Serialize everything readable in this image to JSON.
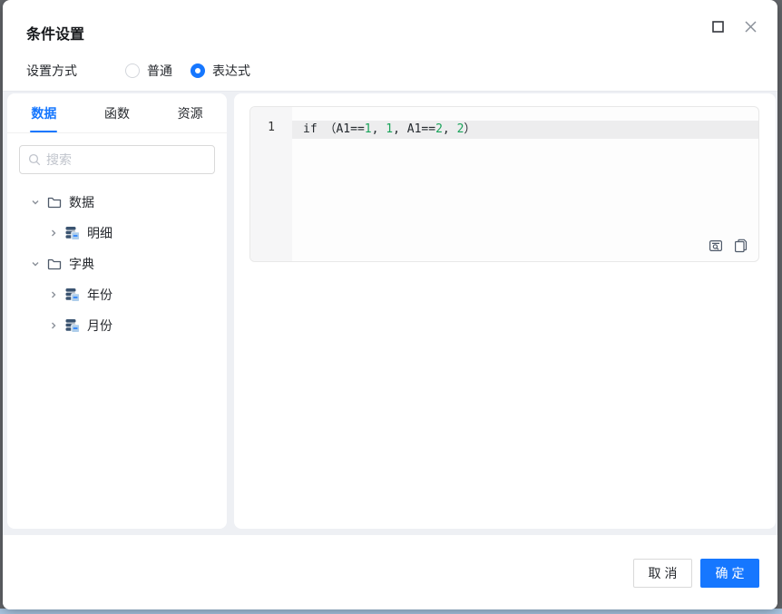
{
  "dialog": {
    "title": "条件设置",
    "mode": {
      "label": "设置方式",
      "options": [
        {
          "label": "普通",
          "selected": false
        },
        {
          "label": "表达式",
          "selected": true
        }
      ]
    }
  },
  "sidebar": {
    "tabs": [
      {
        "label": "数据",
        "active": true
      },
      {
        "label": "函数",
        "active": false
      },
      {
        "label": "资源",
        "active": false
      }
    ],
    "search": {
      "placeholder": "搜索",
      "value": ""
    },
    "tree": [
      {
        "label": "数据",
        "type": "folder",
        "expanded": true,
        "children": [
          {
            "label": "明细",
            "type": "dataset"
          }
        ]
      },
      {
        "label": "字典",
        "type": "folder",
        "expanded": true,
        "children": [
          {
            "label": "年份",
            "type": "dataset"
          },
          {
            "label": "月份",
            "type": "dataset"
          }
        ]
      }
    ]
  },
  "editor": {
    "line_number": "1",
    "code_text": "if （A1==1, 1, A1==2, 2）",
    "tokens": [
      {
        "text": "if （A1==",
        "cls": "tok tok-plain"
      },
      {
        "text": "1",
        "cls": "tok tok-num"
      },
      {
        "text": ", ",
        "cls": "tok tok-plain"
      },
      {
        "text": "1",
        "cls": "tok tok-num"
      },
      {
        "text": ", A1==",
        "cls": "tok tok-plain"
      },
      {
        "text": "2",
        "cls": "tok tok-num"
      },
      {
        "text": ", ",
        "cls": "tok tok-plain"
      },
      {
        "text": "2",
        "cls": "tok tok-num"
      },
      {
        "text": "）",
        "cls": "tok tok-plain"
      }
    ],
    "action_icons": [
      "inspect-code",
      "copy"
    ]
  },
  "footer": {
    "cancel_label": "取消",
    "ok_label": "确定"
  },
  "colors": {
    "accent": "#1677ff",
    "number_green": "#1aa35a",
    "body_background": "#eef0f4"
  }
}
